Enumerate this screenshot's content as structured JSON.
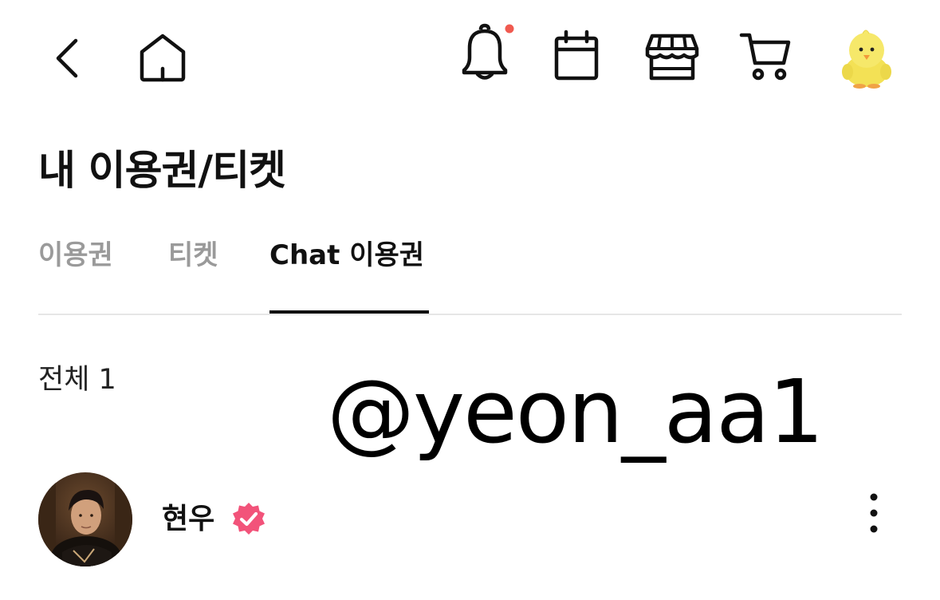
{
  "header": {
    "back_icon": "chevron-left-icon",
    "home_icon": "home-icon",
    "notification_icon": "bell-icon",
    "notification_dot_color": "#f05a50",
    "calendar_icon": "calendar-icon",
    "store_icon": "store-icon",
    "cart_icon": "cart-icon",
    "profile_avatar": "yellow-chick-plush"
  },
  "page": {
    "title": "내 이용권/티켓"
  },
  "tabs": [
    {
      "label": "이용권",
      "active": false
    },
    {
      "label": "티켓",
      "active": false
    },
    {
      "label": "Chat 이용권",
      "active": true
    }
  ],
  "list": {
    "count_label": "전체 1",
    "items": [
      {
        "name": "현우",
        "verified": true,
        "verified_color": "#f2537a",
        "avatar": "artist-photo",
        "more_icon": "more-vertical-icon"
      }
    ]
  },
  "watermark": {
    "text": "@yeon_aa1"
  }
}
